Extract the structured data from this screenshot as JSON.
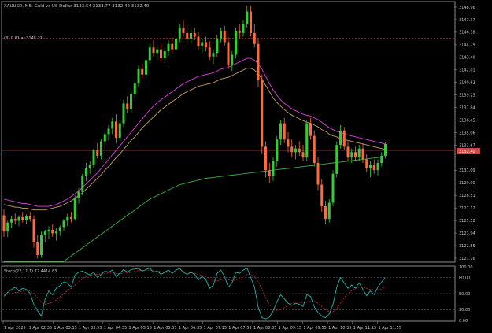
{
  "header": {
    "symbol_title": "XAUUSD, M5:  Gold vs US Dollar  3133.54 3133.77 3132.42 3132.40"
  },
  "indicator_label": "Stoch(22,11,1) 72.4414.83",
  "level_label": "(B) 0.61 at 3145.21",
  "price_axis": [
    "3148.96",
    "3147.37",
    "3146.18",
    "3144.79",
    "3143.40",
    "3142.01",
    "3140.62",
    "3139.23",
    "3137.84",
    "3136.45",
    "3135.06",
    "3133.67",
    "3132.40",
    "3131.09",
    "3129.90",
    "3128.51",
    "3127.12",
    "3125.52",
    "3123.94",
    "3122.55",
    "3121.16"
  ],
  "current_price": "3132.40",
  "stoch_axis": [
    "100.00",
    "80.00",
    "50.00",
    "20.00",
    "0.00"
  ],
  "time_axis": [
    "1 Apr 2025",
    "1 Apr 02:35",
    "1 Apr 03:15",
    "1 Apr 03:55",
    "1 Apr 04:35",
    "1 Apr 05:15",
    "1 Apr 05:55",
    "1 Apr 06:35",
    "1 Apr 07:15",
    "1 Apr 07:55",
    "1 Apr 08:35",
    "1 Apr 09:15",
    "1 Apr 09:55",
    "1 Apr 10:35",
    "1 Apr 11:15",
    "1 Apr 11:55"
  ],
  "colors": {
    "background": "#000000",
    "bull": "#32cd32",
    "bear": "#ff6a3d",
    "ma_fast": "#e040e0",
    "ma_mid": "#c8a060",
    "ma_slow": "#3cb043",
    "stoch_main": "#20b2aa",
    "stoch_signal": "#d03030",
    "grid": "#505050"
  },
  "chart_data": {
    "type": "candlestick",
    "ylim": [
      3120.5,
      3149.2
    ],
    "ohlc": [
      [
        3125.6,
        3126.3,
        3123.2,
        3123.8
      ],
      [
        3123.8,
        3125.0,
        3123.2,
        3124.8
      ],
      [
        3124.8,
        3125.5,
        3124.2,
        3125.2
      ],
      [
        3125.2,
        3125.8,
        3124.6,
        3125.0
      ],
      [
        3125.0,
        3125.6,
        3124.4,
        3125.4
      ],
      [
        3125.4,
        3126.0,
        3124.8,
        3125.1
      ],
      [
        3125.1,
        3125.7,
        3124.6,
        3125.5
      ],
      [
        3125.5,
        3126.0,
        3124.9,
        3125.2
      ],
      [
        3125.2,
        3125.6,
        3122.0,
        3122.6
      ],
      [
        3122.6,
        3123.4,
        3120.8,
        3121.2
      ],
      [
        3121.2,
        3123.8,
        3120.9,
        3123.4
      ],
      [
        3123.4,
        3124.0,
        3122.6,
        3123.8
      ],
      [
        3123.8,
        3124.4,
        3123.0,
        3124.0
      ],
      [
        3124.0,
        3124.6,
        3123.2,
        3123.6
      ],
      [
        3123.6,
        3124.2,
        3122.8,
        3123.9
      ],
      [
        3123.9,
        3124.5,
        3123.3,
        3124.3
      ],
      [
        3124.3,
        3125.2,
        3123.9,
        3125.0
      ],
      [
        3125.0,
        3125.8,
        3124.4,
        3125.4
      ],
      [
        3125.4,
        3126.0,
        3124.8,
        3125.2
      ],
      [
        3125.2,
        3127.8,
        3125.0,
        3127.5
      ],
      [
        3127.5,
        3128.6,
        3126.9,
        3128.2
      ],
      [
        3128.2,
        3130.2,
        3127.8,
        3130.0
      ],
      [
        3130.0,
        3131.4,
        3129.4,
        3130.8
      ],
      [
        3130.8,
        3131.6,
        3130.2,
        3131.2
      ],
      [
        3131.2,
        3133.0,
        3130.8,
        3132.8
      ],
      [
        3132.8,
        3133.6,
        3131.9,
        3132.2
      ],
      [
        3132.2,
        3134.0,
        3131.8,
        3133.8
      ],
      [
        3133.8,
        3135.0,
        3133.0,
        3134.6
      ],
      [
        3134.6,
        3135.6,
        3133.9,
        3135.2
      ],
      [
        3135.2,
        3136.4,
        3134.6,
        3136.0
      ],
      [
        3136.0,
        3136.8,
        3133.6,
        3134.2
      ],
      [
        3134.2,
        3136.2,
        3133.8,
        3135.8
      ],
      [
        3135.8,
        3138.4,
        3135.4,
        3138.0
      ],
      [
        3138.0,
        3138.8,
        3136.9,
        3137.4
      ],
      [
        3137.4,
        3139.4,
        3137.0,
        3139.0
      ],
      [
        3139.0,
        3140.6,
        3138.6,
        3140.2
      ],
      [
        3140.2,
        3142.2,
        3139.8,
        3141.8
      ],
      [
        3141.8,
        3142.4,
        3140.8,
        3141.2
      ],
      [
        3141.2,
        3143.2,
        3140.8,
        3142.8
      ],
      [
        3142.8,
        3144.6,
        3142.4,
        3144.2
      ],
      [
        3144.2,
        3145.0,
        3143.2,
        3143.6
      ],
      [
        3143.6,
        3144.4,
        3142.8,
        3144.0
      ],
      [
        3144.0,
        3144.6,
        3142.6,
        3143.0
      ],
      [
        3143.0,
        3144.2,
        3142.4,
        3143.8
      ],
      [
        3143.8,
        3145.0,
        3143.3,
        3144.6
      ],
      [
        3144.6,
        3145.4,
        3143.6,
        3144.0
      ],
      [
        3144.0,
        3145.6,
        3143.6,
        3145.2
      ],
      [
        3145.2,
        3146.8,
        3144.8,
        3146.4
      ],
      [
        3146.4,
        3147.2,
        3145.4,
        3145.8
      ],
      [
        3145.8,
        3146.6,
        3144.8,
        3145.2
      ],
      [
        3145.2,
        3146.2,
        3144.6,
        3145.8
      ],
      [
        3145.8,
        3146.4,
        3145.0,
        3145.4
      ],
      [
        3145.4,
        3145.9,
        3144.0,
        3144.4
      ],
      [
        3144.4,
        3145.2,
        3143.6,
        3144.8
      ],
      [
        3144.8,
        3145.4,
        3143.8,
        3144.2
      ],
      [
        3144.2,
        3144.9,
        3142.8,
        3143.2
      ],
      [
        3143.2,
        3144.0,
        3142.4,
        3143.6
      ],
      [
        3143.6,
        3145.6,
        3143.2,
        3145.2
      ],
      [
        3145.2,
        3146.4,
        3144.8,
        3146.0
      ],
      [
        3146.0,
        3146.6,
        3144.4,
        3144.8
      ],
      [
        3144.8,
        3145.4,
        3141.8,
        3142.2
      ],
      [
        3142.2,
        3143.8,
        3141.6,
        3143.4
      ],
      [
        3143.4,
        3146.4,
        3143.0,
        3146.0
      ],
      [
        3146.0,
        3146.8,
        3145.2,
        3145.8
      ],
      [
        3145.8,
        3147.2,
        3145.4,
        3146.8
      ],
      [
        3146.8,
        3148.8,
        3146.4,
        3148.2
      ],
      [
        3148.2,
        3148.8,
        3145.4,
        3145.8
      ],
      [
        3145.8,
        3146.8,
        3144.2,
        3144.6
      ],
      [
        3144.6,
        3145.2,
        3139.8,
        3140.6
      ],
      [
        3140.6,
        3141.2,
        3132.4,
        3133.2
      ],
      [
        3133.2,
        3133.8,
        3129.8,
        3130.6
      ],
      [
        3130.6,
        3131.4,
        3129.2,
        3130.0
      ],
      [
        3130.0,
        3132.0,
        3129.4,
        3131.6
      ],
      [
        3131.6,
        3134.4,
        3131.0,
        3134.0
      ],
      [
        3134.0,
        3136.2,
        3133.4,
        3135.8
      ],
      [
        3135.8,
        3136.4,
        3133.6,
        3134.0
      ],
      [
        3134.0,
        3134.8,
        3132.6,
        3133.2
      ],
      [
        3133.2,
        3134.0,
        3132.0,
        3132.6
      ],
      [
        3132.6,
        3133.4,
        3131.8,
        3133.0
      ],
      [
        3133.0,
        3133.8,
        3132.2,
        3132.6
      ],
      [
        3132.6,
        3133.4,
        3131.6,
        3132.0
      ],
      [
        3132.0,
        3136.2,
        3131.6,
        3135.8
      ],
      [
        3135.8,
        3136.4,
        3134.0,
        3134.4
      ],
      [
        3134.4,
        3135.0,
        3131.0,
        3131.4
      ],
      [
        3131.4,
        3132.0,
        3128.4,
        3129.0
      ],
      [
        3129.0,
        3129.6,
        3126.0,
        3126.6
      ],
      [
        3126.6,
        3127.2,
        3124.6,
        3125.2
      ],
      [
        3125.2,
        3127.4,
        3124.8,
        3127.0
      ],
      [
        3127.0,
        3130.6,
        3126.6,
        3130.2
      ],
      [
        3130.2,
        3133.8,
        3129.8,
        3133.4
      ],
      [
        3133.4,
        3135.6,
        3133.0,
        3135.0
      ],
      [
        3135.0,
        3135.4,
        3132.8,
        3133.2
      ],
      [
        3133.2,
        3133.8,
        3131.6,
        3132.0
      ],
      [
        3132.0,
        3133.0,
        3131.4,
        3132.6
      ],
      [
        3132.6,
        3133.2,
        3131.6,
        3132.0
      ],
      [
        3132.0,
        3133.4,
        3131.6,
        3133.0
      ],
      [
        3133.0,
        3133.6,
        3131.4,
        3131.8
      ],
      [
        3131.8,
        3132.4,
        3130.4,
        3130.8
      ],
      [
        3130.8,
        3131.6,
        3129.8,
        3131.2
      ],
      [
        3131.2,
        3131.8,
        3130.2,
        3130.6
      ],
      [
        3130.6,
        3131.8,
        3130.0,
        3131.4
      ],
      [
        3131.4,
        3132.6,
        3131.0,
        3132.2
      ],
      [
        3132.2,
        3133.7,
        3131.9,
        3133.5
      ]
    ],
    "ma_fast": [
      3127.4,
      3127.3,
      3127.2,
      3127.1,
      3127.0,
      3126.9,
      3126.9,
      3126.8,
      3126.7,
      3126.6,
      3126.6,
      3126.6,
      3126.6,
      3126.7,
      3126.8,
      3127.0,
      3127.2,
      3127.4,
      3127.7,
      3128.0,
      3128.3,
      3128.7,
      3129.1,
      3129.5,
      3129.9,
      3130.3,
      3130.8,
      3131.3,
      3131.8,
      3132.3,
      3132.8,
      3133.3,
      3133.8,
      3134.3,
      3134.8,
      3135.3,
      3135.8,
      3136.3,
      3136.8,
      3137.3,
      3137.7,
      3138.1,
      3138.4,
      3138.7,
      3139.0,
      3139.3,
      3139.6,
      3139.9,
      3140.2,
      3140.4,
      3140.6,
      3140.8,
      3141.0,
      3141.1,
      3141.2,
      3141.3,
      3141.4,
      3141.6,
      3141.8,
      3141.9,
      3142.0,
      3142.2,
      3142.4,
      3142.6,
      3142.8,
      3143.0,
      3143.0,
      3142.8,
      3142.4,
      3141.8,
      3141.0,
      3140.2,
      3139.5,
      3138.9,
      3138.4,
      3138.0,
      3137.7,
      3137.4,
      3137.2,
      3137.0,
      3136.8,
      3136.7,
      3136.6,
      3136.4,
      3136.2,
      3135.9,
      3135.6,
      3135.3,
      3135.1,
      3134.9,
      3134.8,
      3134.6,
      3134.5,
      3134.4,
      3134.3,
      3134.2,
      3134.1,
      3134.0,
      3133.9,
      3133.8,
      3133.7,
      3133.6,
      3133.5
    ],
    "ma_mid": [
      3126.8,
      3126.7,
      3126.6,
      3126.5,
      3126.5,
      3126.4,
      3126.4,
      3126.3,
      3126.2,
      3126.2,
      3126.2,
      3126.2,
      3126.3,
      3126.4,
      3126.5,
      3126.6,
      3126.8,
      3127.0,
      3127.2,
      3127.5,
      3127.8,
      3128.1,
      3128.5,
      3128.9,
      3129.3,
      3129.7,
      3130.1,
      3130.6,
      3131.0,
      3131.5,
      3132.0,
      3132.4,
      3132.9,
      3133.4,
      3133.9,
      3134.3,
      3134.8,
      3135.3,
      3135.7,
      3136.1,
      3136.5,
      3136.9,
      3137.3,
      3137.6,
      3137.9,
      3138.2,
      3138.5,
      3138.8,
      3139.1,
      3139.3,
      3139.5,
      3139.7,
      3139.9,
      3140.0,
      3140.1,
      3140.2,
      3140.3,
      3140.5,
      3140.7,
      3140.8,
      3140.9,
      3141.1,
      3141.3,
      3141.5,
      3141.7,
      3141.9,
      3141.9,
      3141.7,
      3141.3,
      3140.7,
      3140.0,
      3139.3,
      3138.6,
      3138.1,
      3137.7,
      3137.3,
      3137.0,
      3136.7,
      3136.5,
      3136.3,
      3136.1,
      3135.9,
      3135.8,
      3135.6,
      3135.4,
      3135.1,
      3134.9,
      3134.6,
      3134.4,
      3134.3,
      3134.1,
      3134.0,
      3133.9,
      3133.8,
      3133.7,
      3133.6,
      3133.5,
      3133.4,
      3133.3,
      3133.2,
      3133.1,
      3133.0,
      3132.9
    ],
    "ma_slow": [
      3114.0,
      3114.4,
      3114.8,
      3115.2,
      3115.6,
      3116.0,
      3116.4,
      3116.8,
      3117.2,
      3117.6,
      3118.0,
      3118.4,
      3118.8,
      3119.2,
      3119.6,
      3120.0,
      3120.4,
      3120.8,
      3121.1,
      3121.4,
      3121.7,
      3122.0,
      3122.3,
      3122.6,
      3122.9,
      3123.2,
      3123.5,
      3123.8,
      3124.1,
      3124.4,
      3124.7,
      3125.0,
      3125.3,
      3125.6,
      3125.9,
      3126.2,
      3126.5,
      3126.8,
      3127.1,
      3127.4,
      3127.6,
      3127.8,
      3128.0,
      3128.2,
      3128.4,
      3128.6,
      3128.8,
      3129.0,
      3129.1,
      3129.2,
      3129.3,
      3129.4,
      3129.5,
      3129.6,
      3129.7,
      3129.75,
      3129.8,
      3129.85,
      3129.9,
      3129.95,
      3130.0,
      3130.05,
      3130.1,
      3130.15,
      3130.2,
      3130.25,
      3130.3,
      3130.35,
      3130.4,
      3130.45,
      3130.5,
      3130.55,
      3130.6,
      3130.65,
      3130.7,
      3130.75,
      3130.8,
      3130.85,
      3130.9,
      3130.95,
      3131.0,
      3131.05,
      3131.1,
      3131.15,
      3131.2,
      3131.25,
      3131.3,
      3131.35,
      3131.4,
      3131.45,
      3131.5,
      3131.55,
      3131.6,
      3131.65,
      3131.7,
      3131.75,
      3131.8,
      3131.85,
      3131.9,
      3131.95,
      3132.0,
      3132.05,
      3132.1
    ],
    "stoch_main": [
      45,
      52,
      58,
      62,
      55,
      60,
      58,
      50,
      30,
      18,
      8,
      40,
      55,
      48,
      60,
      65,
      72,
      70,
      62,
      85,
      90,
      92,
      88,
      85,
      90,
      80,
      86,
      92,
      90,
      94,
      82,
      88,
      95,
      90,
      95,
      96,
      97,
      92,
      95,
      98,
      90,
      92,
      86,
      90,
      94,
      88,
      94,
      97,
      90,
      86,
      90,
      86,
      76,
      82,
      76,
      60,
      66,
      88,
      94,
      82,
      62,
      70,
      90,
      88,
      94,
      98,
      80,
      62,
      25,
      5,
      3,
      6,
      18,
      35,
      48,
      40,
      32,
      28,
      32,
      30,
      26,
      48,
      45,
      25,
      15,
      8,
      5,
      12,
      30,
      62,
      80,
      70,
      60,
      66,
      60,
      70,
      58,
      46,
      55,
      48,
      62,
      72,
      80
    ],
    "stoch_signal": [
      48,
      49,
      50,
      52,
      53,
      55,
      56,
      55,
      50,
      42,
      34,
      30,
      32,
      34,
      38,
      44,
      50,
      56,
      60,
      66,
      72,
      78,
      82,
      84,
      86,
      86,
      87,
      88,
      89,
      90,
      88,
      87,
      88,
      89,
      90,
      92,
      93,
      93,
      94,
      94,
      93,
      92,
      91,
      90,
      90,
      90,
      90,
      91,
      91,
      90,
      89,
      88,
      86,
      84,
      82,
      78,
      74,
      74,
      76,
      78,
      76,
      74,
      76,
      78,
      82,
      86,
      86,
      82,
      72,
      58,
      42,
      30,
      22,
      18,
      20,
      24,
      28,
      32,
      34,
      34,
      32,
      34,
      36,
      36,
      32,
      26,
      20,
      16,
      16,
      22,
      32,
      42,
      50,
      56,
      60,
      62,
      62,
      60,
      58,
      57,
      57,
      58,
      62
    ]
  }
}
